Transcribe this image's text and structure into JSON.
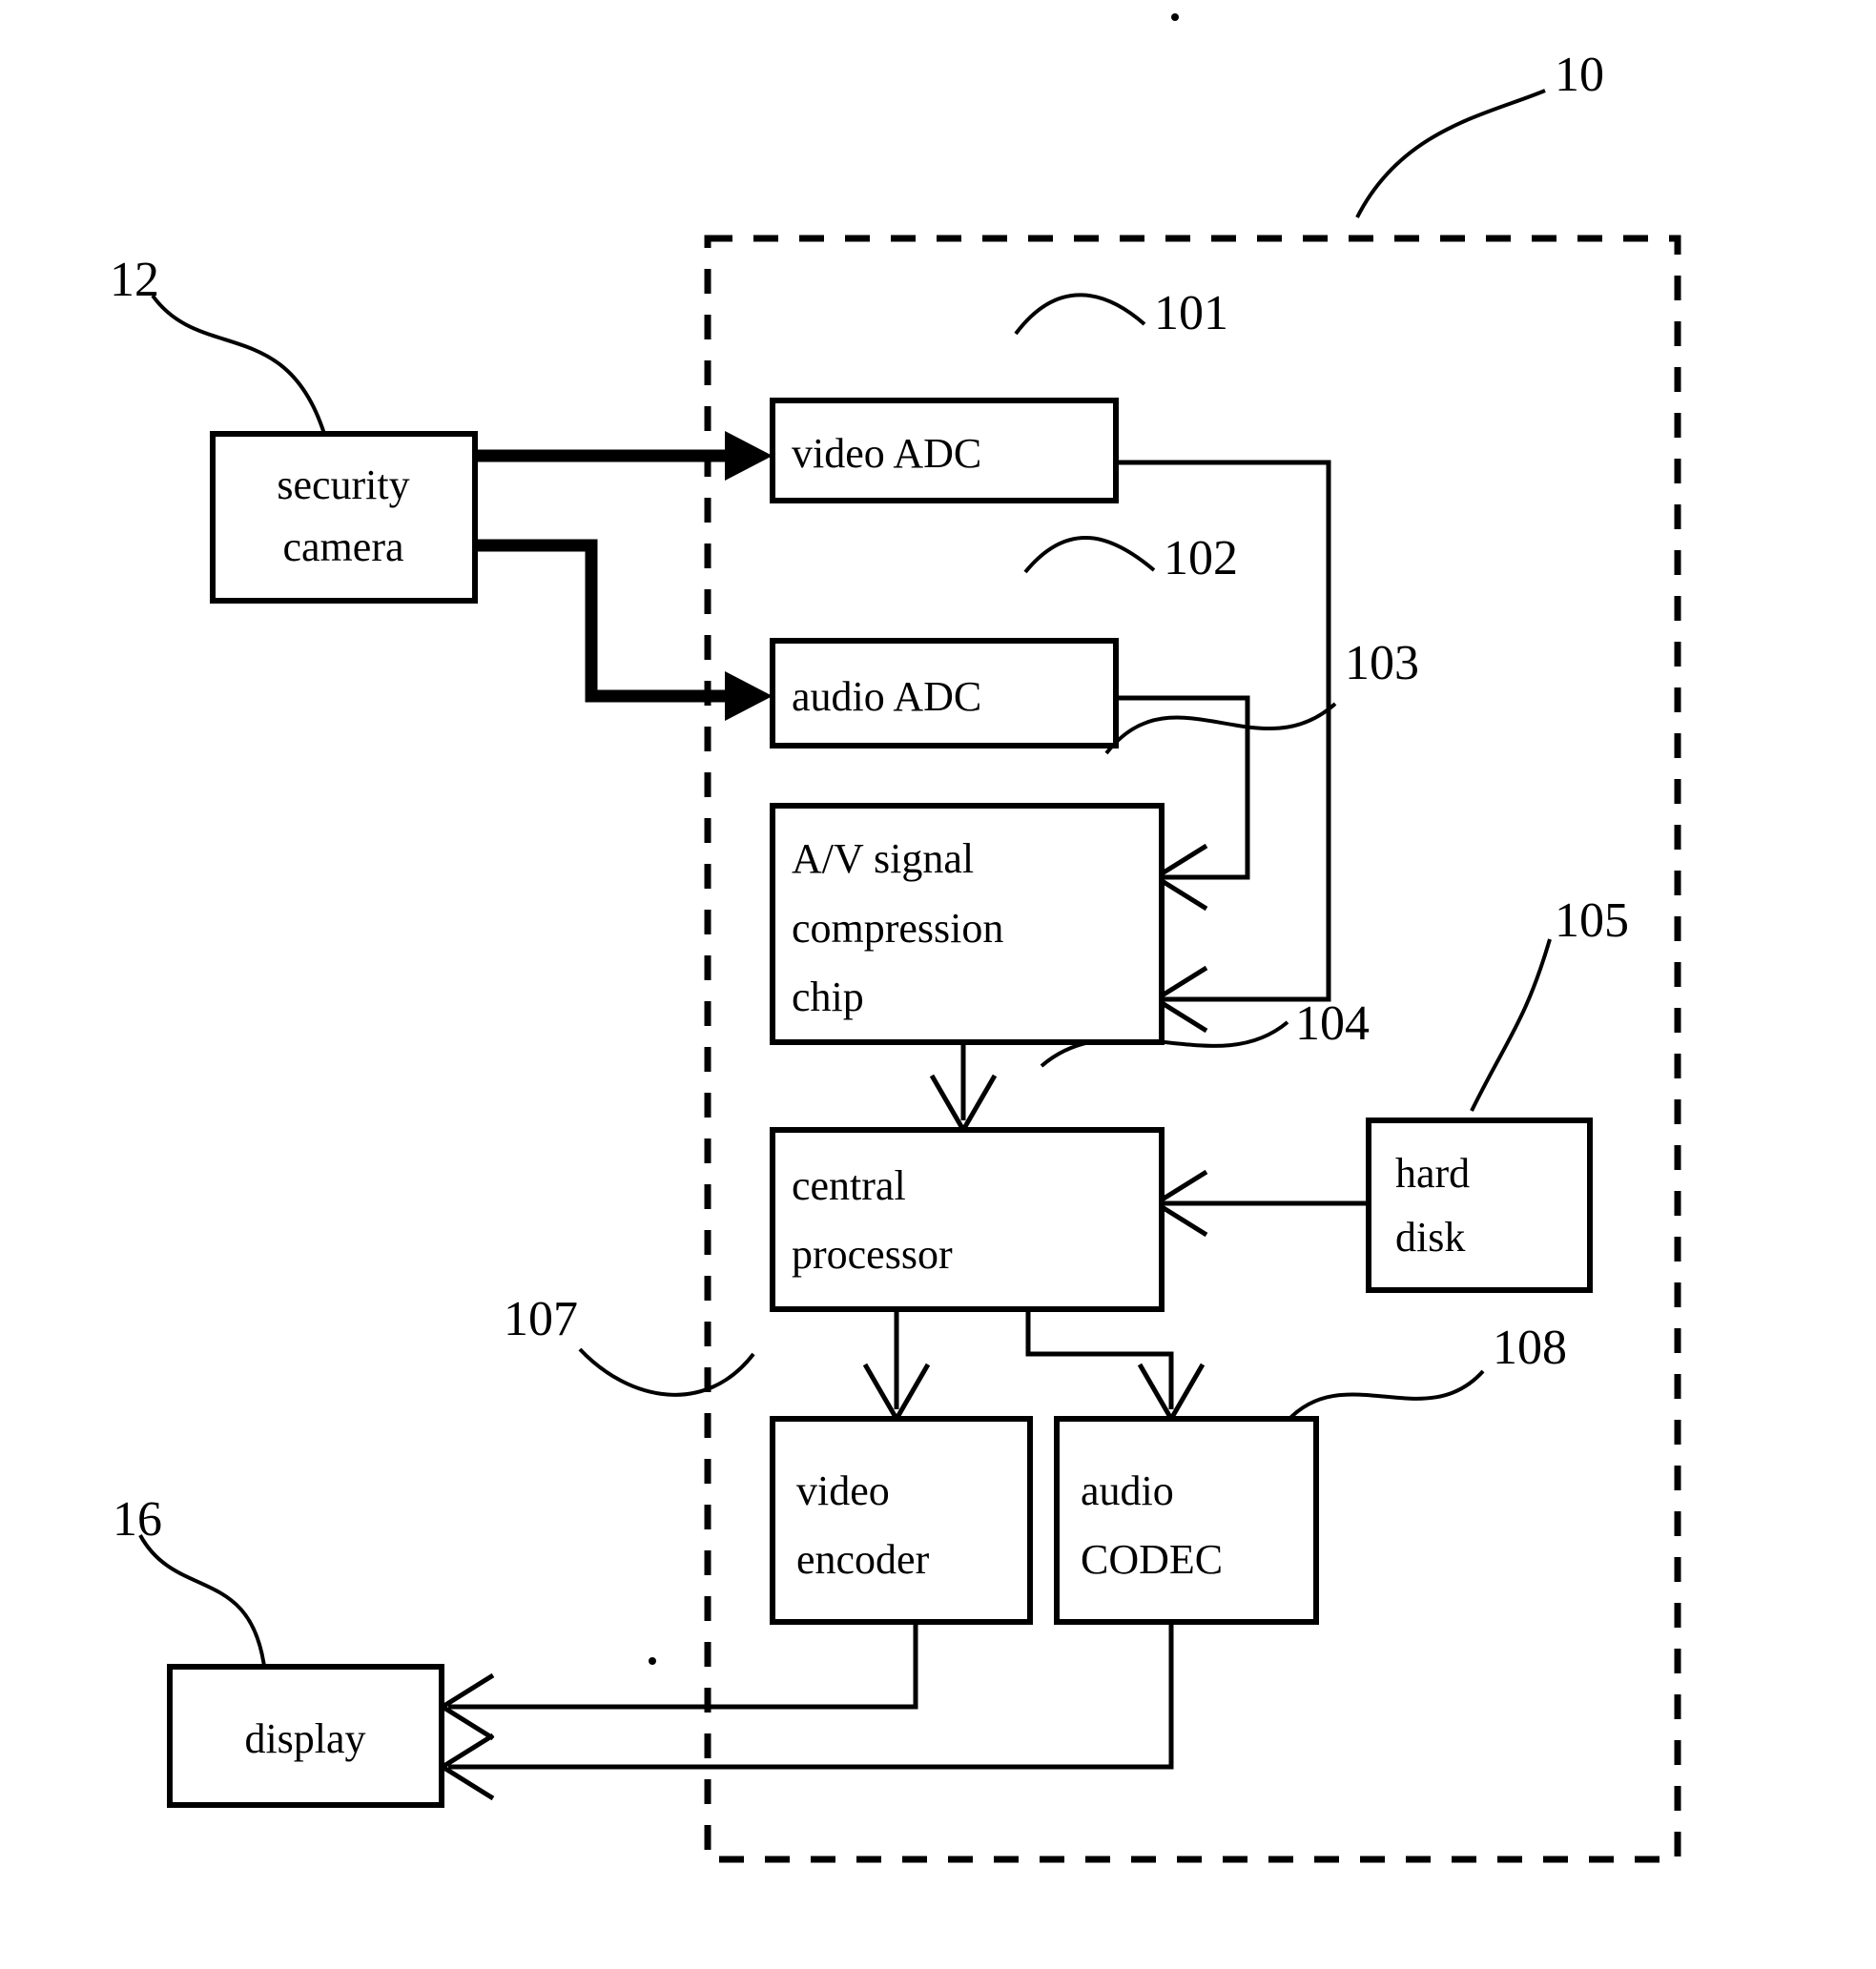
{
  "figure": {
    "title": "security camera recording system block diagram",
    "background_color": "#ffffff",
    "line_color": "#000000"
  },
  "blocks": {
    "security_camera": {
      "line1": "security",
      "line2": "camera"
    },
    "video_adc": {
      "line1": "video ADC"
    },
    "audio_adc": {
      "line1": "audio ADC"
    },
    "compression_chip": {
      "line1": "A/V signal",
      "line2": "compression",
      "line3": "chip"
    },
    "central_processor": {
      "line1": "central",
      "line2": "processor"
    },
    "hard_disk": {
      "line1": "hard",
      "line2": "disk"
    },
    "video_encoder": {
      "line1": "video",
      "line2": "encoder"
    },
    "audio_codec": {
      "line1": "audio",
      "line2": "CODEC"
    },
    "display": {
      "line1": "display"
    }
  },
  "reference_numerals": {
    "system": "10",
    "camera": "12",
    "display": "16",
    "video_adc": "101",
    "audio_adc": "102",
    "audio_path": "103",
    "video_path": "104",
    "hard_disk": "105",
    "video_encoder": "107",
    "audio_codec": "108"
  }
}
